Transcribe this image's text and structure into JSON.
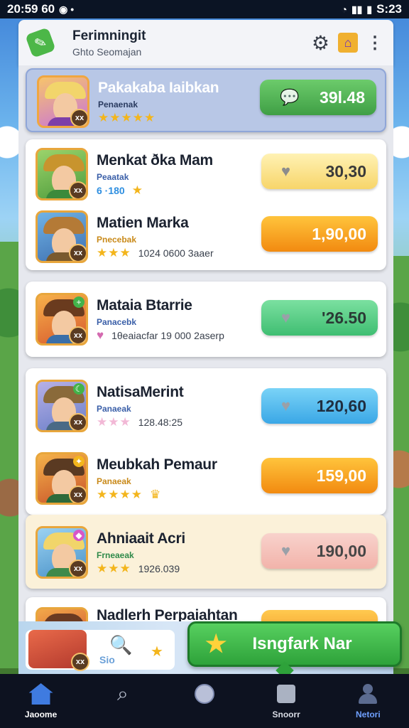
{
  "status_bar": {
    "time": "20:59 60",
    "right_time": "S:23"
  },
  "header": {
    "title": "Ferimningit",
    "subtitle": "Ghto Seomajan"
  },
  "items": [
    {
      "name": "Pakakaba Iaibkan",
      "sub": "Penaenak",
      "meta": "",
      "stars": "★★★★★",
      "price": "39l.48",
      "style": "green"
    },
    {
      "name": "Menkat ðka Mam",
      "sub": "Peaatak",
      "meta": "6 ·180",
      "stars": "★",
      "price": "30,30",
      "style": "yellow"
    },
    {
      "name": "Matien Marka",
      "sub": "Pnecebak",
      "meta": "1024 0600 3aaer",
      "stars": "★★★",
      "price": "1,90,00",
      "style": "orange"
    },
    {
      "name": "Mataia Btarrie",
      "sub": "Panacebk",
      "meta": "1θeaiacfar 19 000 2aserp",
      "stars": "♥",
      "price": "'26.50",
      "style": "mint"
    },
    {
      "name": "NatisaMerint",
      "sub": "Panaeak",
      "meta": "128.48:25",
      "stars": "★★★",
      "price": "120,60",
      "style": "sky"
    },
    {
      "name": "Meubkah Pemaur",
      "sub": "Panaeak",
      "meta": "",
      "stars": "★★★★",
      "price": "159,00",
      "style": "orange"
    },
    {
      "name": "Ahniaait Acri",
      "sub": "Frneaeak",
      "meta": "1926.039",
      "stars": "★★★",
      "price": "190,00",
      "style": "rose"
    },
    {
      "name": "Nadlerh Perpaiahtan",
      "sub": "",
      "meta": "",
      "stars": "",
      "price": "",
      "style": "orange"
    }
  ],
  "promo": {
    "badge": "xx",
    "search_text": "Sio",
    "cta_label": "Isngfark Nar"
  },
  "nav": [
    {
      "label": "Jaoome",
      "icon": "home-icon"
    },
    {
      "label": "",
      "icon": "search-icon"
    },
    {
      "label": "",
      "icon": "circle-icon"
    },
    {
      "label": "Snoorr",
      "icon": "square-icon"
    },
    {
      "label": "Netori",
      "icon": "profile-icon"
    }
  ],
  "colors": {
    "accent_green": "#3f9f45",
    "accent_orange": "#f28a10",
    "nav_blue": "#3f7be0"
  }
}
